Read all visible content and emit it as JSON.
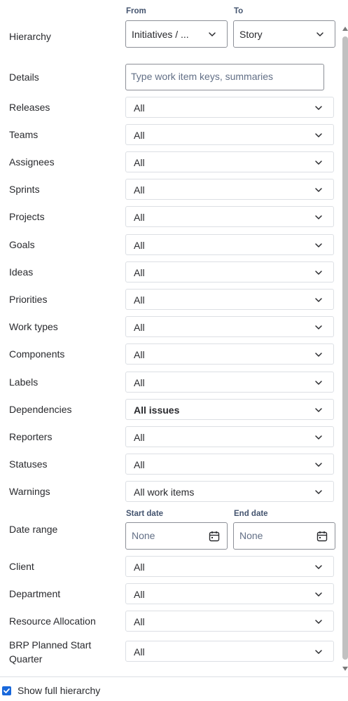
{
  "hierarchy": {
    "label": "Hierarchy",
    "from_label": "From",
    "to_label": "To",
    "from_value": "Initiatives / ...",
    "to_value": "Story"
  },
  "details": {
    "label": "Details",
    "placeholder": "Type work item keys, summaries"
  },
  "filters": [
    {
      "label": "Releases",
      "value": "All"
    },
    {
      "label": "Teams",
      "value": "All"
    },
    {
      "label": "Assignees",
      "value": "All"
    },
    {
      "label": "Sprints",
      "value": "All"
    },
    {
      "label": "Projects",
      "value": "All"
    },
    {
      "label": "Goals",
      "value": "All"
    },
    {
      "label": "Ideas",
      "value": "All"
    },
    {
      "label": "Priorities",
      "value": "All"
    },
    {
      "label": "Work types",
      "value": "All"
    },
    {
      "label": "Components",
      "value": "All"
    },
    {
      "label": "Labels",
      "value": "All"
    },
    {
      "label": "Dependencies",
      "value": "All issues"
    },
    {
      "label": "Reporters",
      "value": "All"
    },
    {
      "label": "Statuses",
      "value": "All"
    },
    {
      "label": "Warnings",
      "value": "All work items"
    }
  ],
  "date_range": {
    "label": "Date range",
    "start_label": "Start date",
    "end_label": "End date",
    "start_placeholder": "None",
    "end_placeholder": "None"
  },
  "custom_filters": [
    {
      "label": "Client",
      "value": "All"
    },
    {
      "label": "Department",
      "value": "All"
    },
    {
      "label": "Resource Allocation",
      "value": "All"
    },
    {
      "label_line1": "BRP Planned Start",
      "label_line2": "Quarter",
      "value": "All"
    }
  ],
  "footer": {
    "show_full_hierarchy_label": "Show full hierarchy",
    "show_full_hierarchy_checked": true
  },
  "colors": {
    "accent": "#1868db",
    "border": "#dcdfe4",
    "text": "#292a2e",
    "subtle": "#626f86"
  }
}
